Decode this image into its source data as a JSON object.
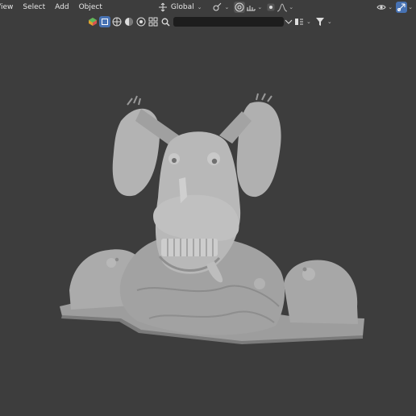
{
  "menu": {
    "view": "View",
    "select": "Select",
    "add": "Add",
    "object": "Object"
  },
  "transform": {
    "orientation": "Global"
  },
  "outliner": {
    "search_placeholder": ""
  },
  "colors": {
    "viewport_bg": "#3d3d3d",
    "model": "#a8a8a8",
    "active_button": "#4772b3",
    "search_bg": "#1d1d1d"
  },
  "icons": [
    "transform-orientation-icon",
    "snap-icon",
    "snap-target-icon",
    "proportional-edit-icon",
    "falloff-icon",
    "collection-icon",
    "object-icon",
    "mesh-icon",
    "lamp-icon",
    "camera-icon",
    "other-icon",
    "search-icon",
    "view-filter-icon",
    "sort-icon",
    "filter-icon",
    "visibility-icon",
    "gizmo-icon"
  ]
}
